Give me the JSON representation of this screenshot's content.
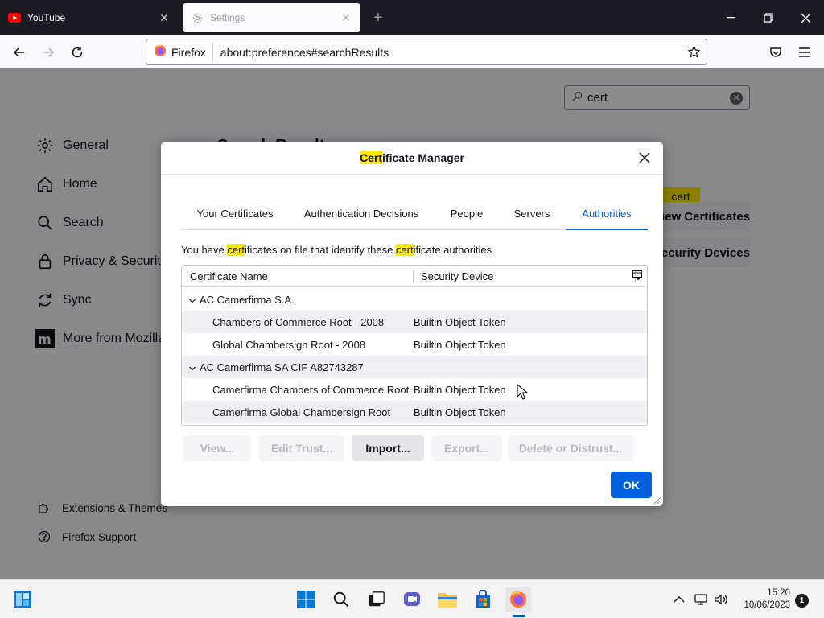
{
  "browser": {
    "tabs": [
      {
        "label": "YouTube",
        "close": "✕",
        "active": false
      },
      {
        "label": "Settings",
        "close": "✕",
        "active": true
      }
    ],
    "new_tab": "+",
    "url_identity": "Firefox",
    "url": "about:preferences#searchResults"
  },
  "settings": {
    "search_value": "cert",
    "search_results_title": "Search Results",
    "categories": [
      {
        "label": "General",
        "icon": "gear-icon"
      },
      {
        "label": "Home",
        "icon": "home-icon"
      },
      {
        "label": "Search",
        "icon": "search-icon"
      },
      {
        "label": "Privacy & Security",
        "icon": "lock-icon"
      },
      {
        "label": "Sync",
        "icon": "sync-icon"
      },
      {
        "label": "More from Mozilla",
        "icon": "mozilla-icon"
      }
    ],
    "footer_links": [
      {
        "label": "Extensions & Themes",
        "icon": "puzzle-icon"
      },
      {
        "label": "Firefox Support",
        "icon": "help-icon"
      }
    ],
    "highlight_tag": "cert",
    "bg_buttons": [
      {
        "label": "View Certificates..."
      },
      {
        "label": "Security Devices..."
      }
    ]
  },
  "dialog": {
    "title_highlight": "Cert",
    "title_rest": "ificate Manager",
    "tabs": [
      {
        "label": "Your Certificates",
        "active": false
      },
      {
        "label": "Authentication Decisions",
        "active": false
      },
      {
        "label": "People",
        "active": false
      },
      {
        "label": "Servers",
        "active": false
      },
      {
        "label": "Authorities",
        "active": true
      }
    ],
    "intro": {
      "p1": "You have ",
      "h1": "cert",
      "p2": "ificates on file that identify these ",
      "h2": "cert",
      "p3": "ificate authorities"
    },
    "columns": {
      "name": "Certificate Name",
      "device": "Security Device"
    },
    "rows": [
      {
        "type": "group",
        "name": "AC Camerfirma S.A.",
        "device": ""
      },
      {
        "type": "cert",
        "name": "Chambers of Commerce Root - 2008",
        "device": "Builtin Object Token"
      },
      {
        "type": "cert",
        "name": "Global Chambersign Root - 2008",
        "device": "Builtin Object Token"
      },
      {
        "type": "group",
        "name": "AC Camerfirma SA CIF A82743287",
        "device": ""
      },
      {
        "type": "cert",
        "name": "Camerfirma Chambers of Commerce Root",
        "device": "Builtin Object Token"
      },
      {
        "type": "cert",
        "name": "Camerfirma Global Chambersign Root",
        "device": "Builtin Object Token"
      }
    ],
    "buttons": {
      "view": "View...",
      "edit_trust": "Edit Trust...",
      "import": "Import...",
      "export": "Export...",
      "delete": "Delete or Distrust..."
    },
    "ok": "OK"
  },
  "taskbar": {
    "time": "15:20",
    "date": "10/06/2023",
    "notifications": "1"
  },
  "colors": {
    "accent": "#0061e0",
    "highlight": "#ffe900",
    "tabstrip": "#1c1b22"
  }
}
